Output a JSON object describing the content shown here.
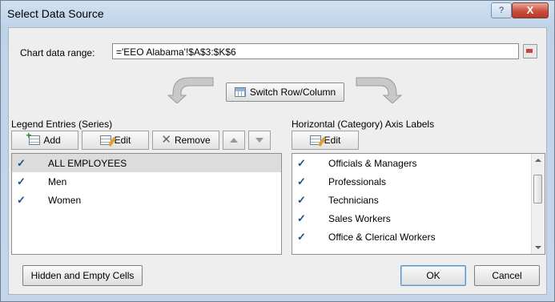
{
  "window": {
    "title": "Select Data Source",
    "help": "?",
    "close": "X"
  },
  "range": {
    "label": "Chart data range:",
    "value": "='EEO Alabama'!$A$3:$K$6"
  },
  "switch_button": "Switch Row/Column",
  "legend": {
    "heading": "Legend Entries (Series)",
    "add": "Add",
    "edit": "Edit",
    "remove": "Remove",
    "items": [
      {
        "label": "ALL EMPLOYEES",
        "checked": true,
        "selected": true
      },
      {
        "label": "Men",
        "checked": true,
        "selected": false
      },
      {
        "label": "Women",
        "checked": true,
        "selected": false
      }
    ]
  },
  "axis": {
    "heading": "Horizontal (Category) Axis Labels",
    "edit": "Edit",
    "items": [
      {
        "label": "Officials & Managers",
        "checked": true
      },
      {
        "label": "Professionals",
        "checked": true
      },
      {
        "label": "Technicians",
        "checked": true
      },
      {
        "label": "Sales Workers",
        "checked": true
      },
      {
        "label": "Office & Clerical Workers",
        "checked": true
      }
    ]
  },
  "buttons": {
    "hidden": "Hidden and Empty Cells",
    "ok": "OK",
    "cancel": "Cancel"
  },
  "check_glyph": "✓"
}
